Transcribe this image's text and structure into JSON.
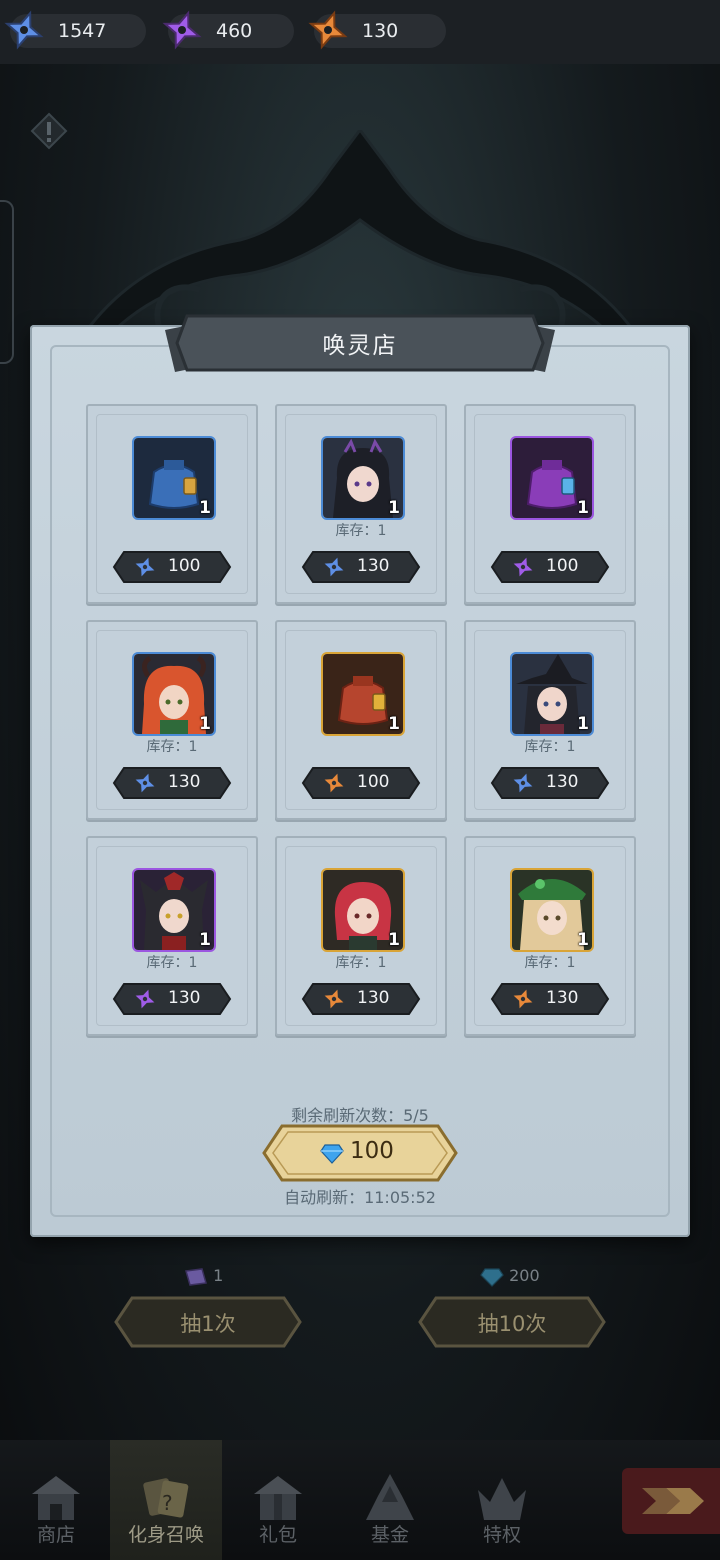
{
  "resources": [
    {
      "icon": "blue-shuriken-icon",
      "value": "1547"
    },
    {
      "icon": "purple-shuriken-icon",
      "value": "460"
    },
    {
      "icon": "orange-shuriken-icon",
      "value": "130"
    }
  ],
  "shop": {
    "title": "唤灵店",
    "items": [
      {
        "icon": "blue-bag-icon",
        "count": "1",
        "stock": "",
        "currency": "blue",
        "price": "100"
      },
      {
        "icon": "dark-horned-girl-icon",
        "count": "1",
        "stock": "库存：1",
        "currency": "blue",
        "price": "130"
      },
      {
        "icon": "purple-bag-icon",
        "count": "1",
        "stock": "",
        "currency": "purple",
        "price": "100"
      },
      {
        "icon": "red-horned-girl-icon",
        "count": "1",
        "stock": "库存：1",
        "currency": "blue",
        "price": "130"
      },
      {
        "icon": "red-bag-icon",
        "count": "1",
        "stock": "",
        "currency": "orange",
        "price": "100"
      },
      {
        "icon": "witch-hat-girl-icon",
        "count": "1",
        "stock": "库存：1",
        "currency": "blue",
        "price": "130"
      },
      {
        "icon": "dark-demon-girl-icon",
        "count": "1",
        "stock": "库存：1",
        "currency": "purple",
        "price": "130"
      },
      {
        "icon": "red-hair-girl-icon",
        "count": "1",
        "stock": "库存：1",
        "currency": "orange",
        "price": "130"
      },
      {
        "icon": "green-hat-girl-icon",
        "count": "1",
        "stock": "库存：1",
        "currency": "orange",
        "price": "130"
      }
    ],
    "refresh_remaining": "剩余刷新次数：5/5",
    "refresh_cost": "100",
    "auto_refresh": "自动刷新：11:05:52"
  },
  "draws": [
    {
      "cost_icon": "ticket-icon",
      "cost": "1",
      "label": "抽1次"
    },
    {
      "cost_icon": "diamond-icon",
      "cost": "200",
      "label": "抽10次"
    }
  ],
  "nav": {
    "items": [
      {
        "label": "商店",
        "icon": "shop-icon"
      },
      {
        "label": "化身召唤",
        "icon": "summon-cards-icon"
      },
      {
        "label": "礼包",
        "icon": "gift-pack-icon"
      },
      {
        "label": "基金",
        "icon": "fund-icon"
      },
      {
        "label": "特权",
        "icon": "privilege-crown-icon"
      }
    ],
    "active_index": 1
  },
  "colors": {
    "blue": "#5e8fe6",
    "purple": "#a05ce8",
    "orange": "#e8893a",
    "gold_button": "#e8d39a",
    "panel": "#c9d6df"
  }
}
